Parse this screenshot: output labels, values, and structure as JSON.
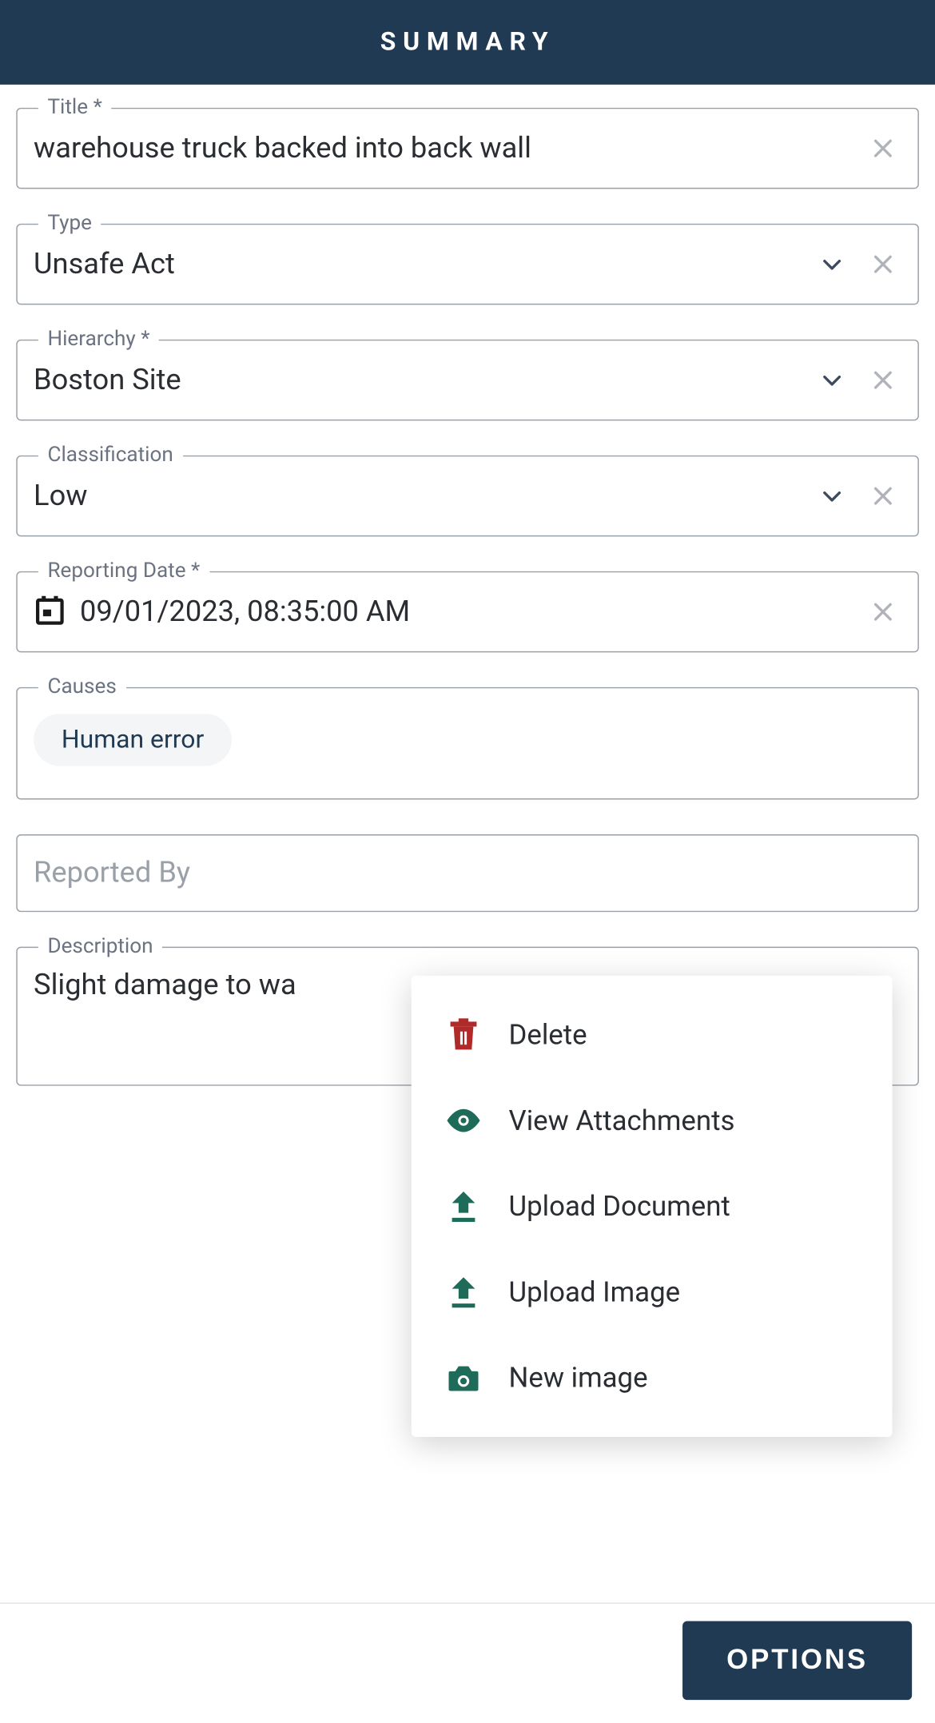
{
  "header": {
    "title": "SUMMARY"
  },
  "fields": {
    "title": {
      "label": "Title *",
      "value": "warehouse truck backed into back wall"
    },
    "type": {
      "label": "Type",
      "value": "Unsafe Act"
    },
    "hierarchy": {
      "label": "Hierarchy *",
      "value": "Boston Site"
    },
    "classification": {
      "label": "Classification",
      "value": "Low"
    },
    "reporting_date": {
      "label": "Reporting Date *",
      "value": "09/01/2023, 08:35:00 AM"
    },
    "causes": {
      "label": "Causes",
      "chips": [
        "Human error"
      ]
    },
    "reported_by": {
      "label": "Reported By",
      "placeholder": "Reported By",
      "value": ""
    },
    "description": {
      "label": "Description",
      "value": "Slight damage to wa"
    }
  },
  "menu": {
    "delete": "Delete",
    "view_attachments": "View Attachments",
    "upload_document": "Upload Document",
    "upload_image": "Upload Image",
    "new_image": "New image"
  },
  "options_button": "OPTIONS",
  "colors": {
    "header_bg": "#1f3a52",
    "delete_icon": "#b02a2a",
    "action_icon": "#1e6b5a"
  }
}
